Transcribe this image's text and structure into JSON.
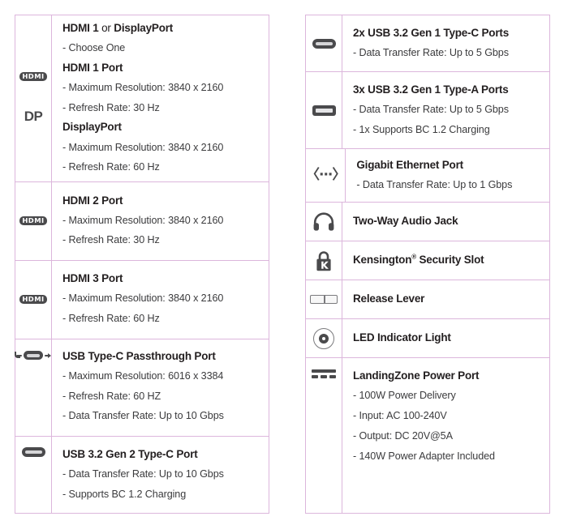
{
  "colors": {
    "border": "#dcb6dc",
    "text": "#231f20",
    "subtext": "#3b3b3d",
    "icon": "#4a4a4c",
    "background": "#ffffff"
  },
  "left_table": {
    "rows": [
      {
        "icons": [
          "hdmi-logo-icon",
          "displayport-icon"
        ],
        "icon_labels": [
          "HDMI",
          "DP"
        ],
        "title_main": "HDMI 1",
        "title_connector": " or ",
        "title_alt": "DisplayPort",
        "lines": [
          "- Choose One"
        ],
        "sub_blocks": [
          {
            "heading": "HDMI 1 Port",
            "lines": [
              "- Maximum Resolution: 3840 x 2160",
              "- Refresh Rate: 30 Hz"
            ]
          },
          {
            "heading": "DisplayPort",
            "lines": [
              "- Maximum Resolution: 3840 x 2160",
              "- Refresh Rate: 60 Hz"
            ]
          }
        ]
      },
      {
        "icons": [
          "hdmi-logo-icon"
        ],
        "icon_labels": [
          "HDMI"
        ],
        "title": "HDMI 2 Port",
        "lines": [
          "- Maximum Resolution: 3840 x 2160",
          "- Refresh Rate: 30 Hz"
        ]
      },
      {
        "icons": [
          "hdmi-logo-icon"
        ],
        "icon_labels": [
          "HDMI"
        ],
        "title": "HDMI 3 Port",
        "lines": [
          "- Maximum Resolution: 3840 x 2160",
          "- Refresh Rate: 60 Hz"
        ]
      },
      {
        "icons": [
          "usb-type-c-passthrough-icon"
        ],
        "icon_labels": [
          ""
        ],
        "title": "USB Type-C Passthrough Port",
        "lines": [
          "- Maximum Resolution: 6016 x 3384",
          "- Refresh Rate: 60 HZ",
          "- Data Transfer Rate: Up to 10 Gbps"
        ]
      },
      {
        "icons": [
          "usb-type-c-icon"
        ],
        "icon_labels": [
          ""
        ],
        "title": "USB 3.2 Gen 2 Type-C Port",
        "lines": [
          "- Data Transfer Rate: Up to 10 Gbps",
          "- Supports BC 1.2 Charging"
        ]
      }
    ]
  },
  "right_table": {
    "rows": [
      {
        "icon": "usb-type-c-icon",
        "title": "2x USB 3.2 Gen 1 Type-C Ports",
        "lines": [
          "- Data Transfer Rate: Up to 5 Gbps"
        ]
      },
      {
        "icon": "usb-type-a-icon",
        "title": "3x USB 3.2 Gen 1 Type-A Ports",
        "lines": [
          "- Data Transfer Rate: Up to 5 Gbps",
          "- 1x Supports BC 1.2 Charging"
        ]
      },
      {
        "icon": "ethernet-icon",
        "icon_glyph": "〈···〉",
        "title": "Gigabit Ethernet Port",
        "lines": [
          "- Data Transfer Rate: Up to 1 Gbps"
        ]
      },
      {
        "icon": "headphone-icon",
        "title": "Two-Way Audio Jack",
        "lines": []
      },
      {
        "icon": "lock-icon",
        "title_main": "Kensington",
        "title_sup": "®",
        "title_rest": " Security Slot",
        "lines": []
      },
      {
        "icon": "release-lever-icon",
        "title": "Release Lever",
        "lines": []
      },
      {
        "icon": "led-indicator-icon",
        "title": "LED Indicator Light",
        "lines": []
      },
      {
        "icon": "power-port-icon",
        "title": "LandingZone Power Port",
        "lines": [
          "- 100W Power Delivery",
          "- Input: AC 100-240V",
          "- Output: DC 20V@5A",
          "- 140W Power Adapter Included"
        ]
      }
    ]
  }
}
